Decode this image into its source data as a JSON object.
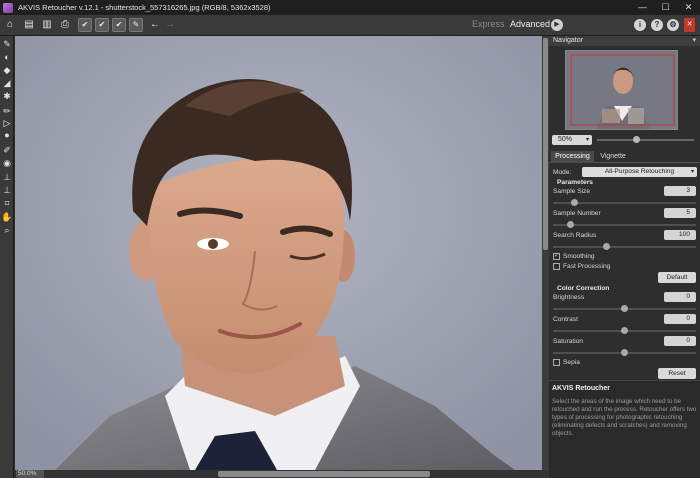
{
  "window": {
    "title": "AKVIS Retoucher v.12.1 - shutterstock_557316265.jpg (RGB/8, 5362x3528)",
    "controls": [
      "—",
      "☐",
      "✕"
    ]
  },
  "toolbar": {
    "icons": [
      "home-icon",
      "open-icon",
      "save-icon",
      "print-icon",
      "image-check-icon",
      "check-icon",
      "remove-objects-icon",
      "batch-icon",
      "undo-icon",
      "redo-icon"
    ],
    "mode_express": "Express",
    "mode_advanced": "Advanced",
    "run_glyph": "▶",
    "about_glyph": "i",
    "help_glyph": "?",
    "settings_glyph": "⚙",
    "bookmark_glyph": "✕"
  },
  "left_tools": [
    "eraser",
    "mask-brush",
    "mask-eraser",
    "selection-brush",
    "magic-wand",
    "pencil",
    "triangle",
    "circle",
    "brush",
    "color-brush",
    "stamp",
    "stamp2",
    "crop",
    "hand",
    "zoom"
  ],
  "status": {
    "zoom": "50.0%"
  },
  "navigator": {
    "title": "Navigator",
    "zoom_value": "50%",
    "zoom_fraction": 0.4
  },
  "tabs": {
    "processing": "Processing",
    "vignette": "Vignette"
  },
  "processing": {
    "mode_label": "Mode:",
    "mode_value": "All-Purpose Retouching",
    "parameters_title": "Parameters",
    "sample_size_label": "Sample Size",
    "sample_size_value": "3",
    "sample_size_fraction": 0.13,
    "sample_number_label": "Sample Number",
    "sample_number_value": "5",
    "sample_number_fraction": 0.1,
    "search_radius_label": "Search Radius",
    "search_radius_value": "100",
    "search_radius_fraction": 0.37,
    "smoothing_label": "Smoothing",
    "smoothing_checked": true,
    "fast_processing_label": "Fast Processing",
    "fast_processing_checked": false,
    "default_button": "Default",
    "color_correction_title": "Color Correction",
    "brightness_label": "Brightness",
    "brightness_value": "0",
    "contrast_label": "Contrast",
    "contrast_value": "0",
    "saturation_label": "Saturation",
    "saturation_value": "0",
    "sepia_label": "Sepia",
    "sepia_checked": false,
    "reset_button": "Reset"
  },
  "info": {
    "title": "AKVIS Retoucher",
    "text": "Select the areas of the image which need to be retouched and run the process. Retoucher offers two types of processing for photographic retouching (eliminating defects and scratches) and removing objects."
  },
  "colors": {
    "canvas_bg": "#9a9fae",
    "panel_bg": "#2e2e2e",
    "toolbar_bg": "#3a3a3a",
    "bookmark_red": "#c0392b"
  }
}
